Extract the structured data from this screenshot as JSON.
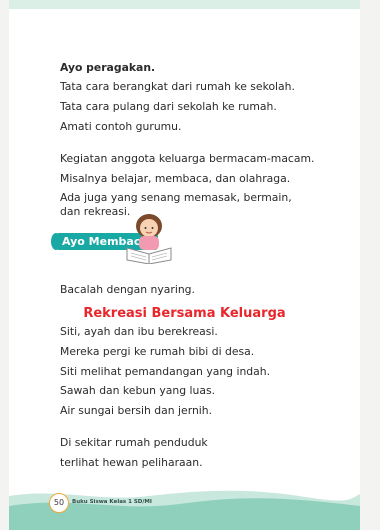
{
  "section1": {
    "heading": "Ayo peragakan.",
    "lines": [
      "Tata cara berangkat dari rumah ke sekolah.",
      "Tata cara pulang dari sekolah ke rumah.",
      "Amati contoh gurumu."
    ]
  },
  "section2": {
    "lines": [
      "Kegiatan anggota keluarga bermacam-macam.",
      "Misalnya belajar, membaca, dan olahraga.",
      "Ada juga yang senang memasak, bermain,",
      "dan rekreasi."
    ]
  },
  "badge": {
    "label": "Ayo Membaca",
    "color": "#19a9a4"
  },
  "instruction": "Bacalah dengan nyaring.",
  "story": {
    "title": "Rekreasi Bersama Keluarga",
    "title_color": "#e8262c",
    "lines": [
      "Siti, ayah dan ibu berekreasi.",
      "Mereka pergi ke rumah bibi di desa.",
      "Siti melihat pemandangan yang indah.",
      "Sawah dan kebun yang luas.",
      "Air sungai bersih dan jernih."
    ],
    "lines2": [
      "Di sekitar rumah penduduk",
      "terlihat hewan peliharaan."
    ]
  },
  "footer": {
    "page_number": "50",
    "book_title": "Buku Siswa Kelas 1 SD/MI"
  }
}
